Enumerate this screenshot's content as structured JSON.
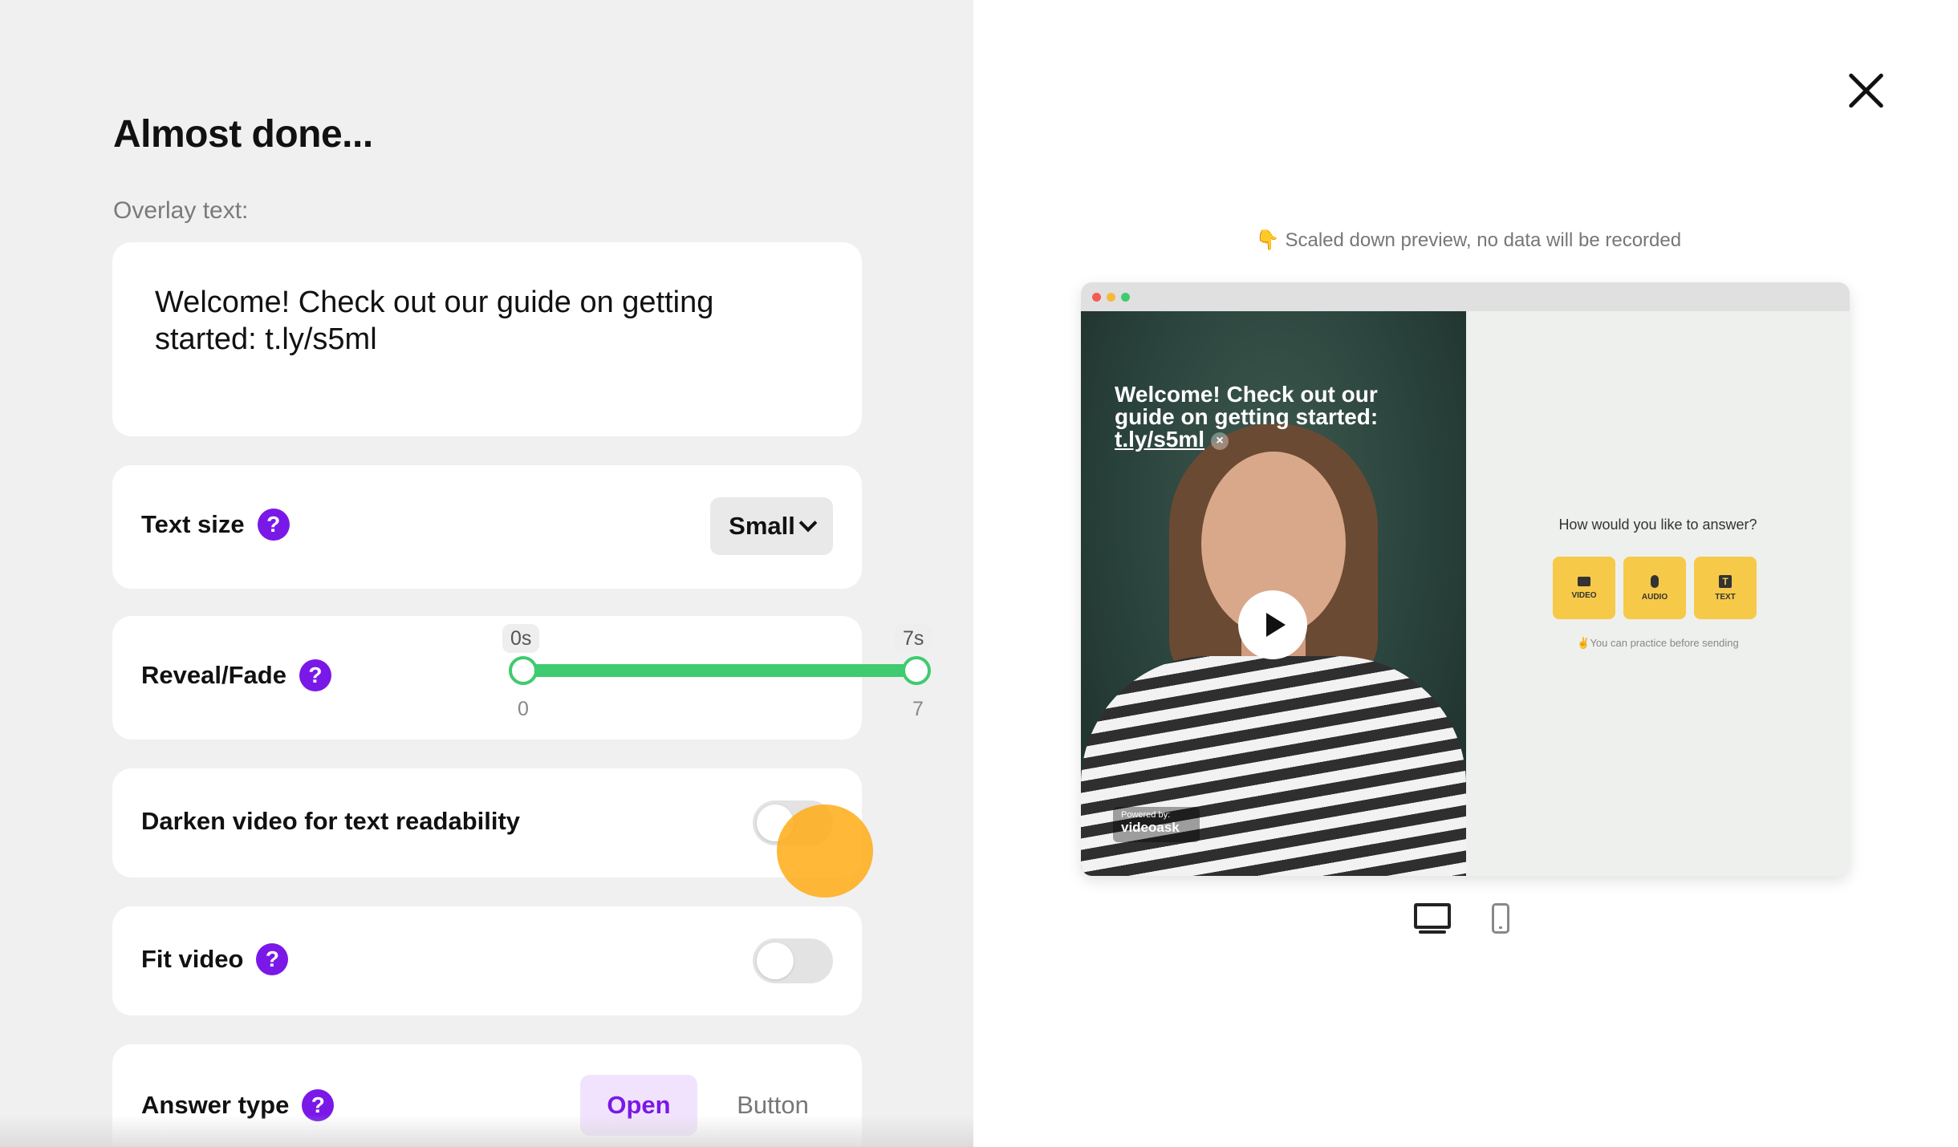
{
  "form": {
    "title": "Almost done...",
    "overlay_label": "Overlay text:",
    "overlay_text": "Welcome! Check out our guide on getting started: t.ly/s5ml",
    "text_size": {
      "label": "Text size",
      "help": "?",
      "value": "Small"
    },
    "reveal_fade": {
      "label": "Reveal/Fade",
      "help": "?",
      "start_value": "0s",
      "end_value": "7s",
      "min_label": "0",
      "max_label": "7",
      "start": 0,
      "end": 7,
      "min": 0,
      "max": 7
    },
    "darken": {
      "label": "Darken video for text readability",
      "enabled": false
    },
    "fit_video": {
      "label": "Fit video",
      "help": "?",
      "enabled": false
    },
    "answer_type": {
      "label": "Answer type",
      "help": "?",
      "options": [
        "Open",
        "Button"
      ],
      "selected": "Open"
    }
  },
  "preview": {
    "note": "👇 Scaled down preview, no data will be recorded",
    "video_title_main": "Welcome! Check out our guide on getting started:",
    "video_title_link": "t.ly/s5ml",
    "dismiss": "×",
    "powered_by": "Powered by:",
    "brand": "videoask",
    "answer_question": "How would you like to answer?",
    "answer_buttons": [
      "VIDEO",
      "AUDIO",
      "TEXT"
    ],
    "text_icon_glyph": "T",
    "practice_note": "✌️You can practice before sending",
    "devices": [
      "desktop-icon",
      "mobile-icon"
    ]
  },
  "colors": {
    "accent": "#7a18e8",
    "slider": "#3fcb6f",
    "answer_button": "#f7c948"
  }
}
